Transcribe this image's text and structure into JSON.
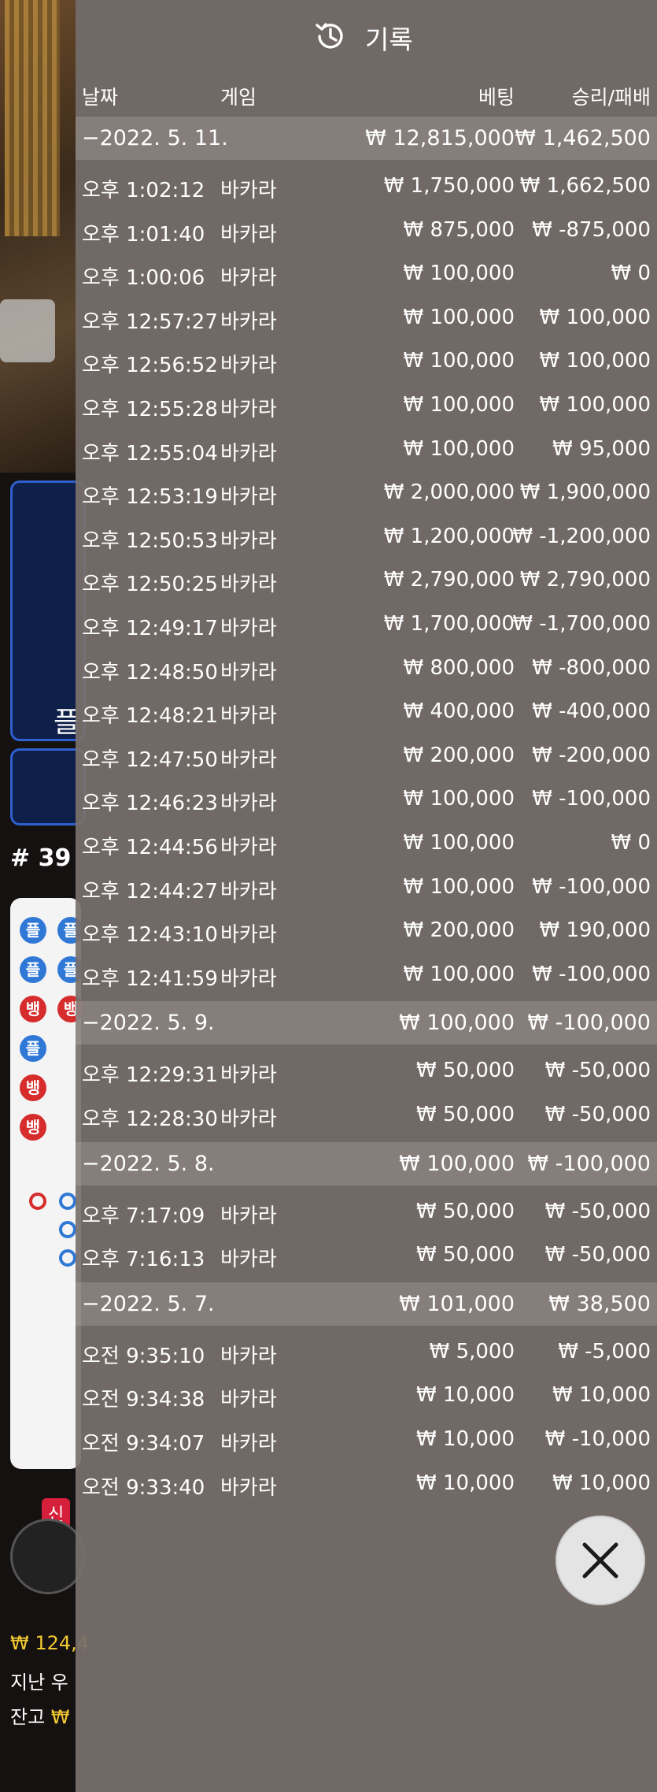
{
  "header": {
    "title": "기록",
    "icon": "history-icon"
  },
  "columns": {
    "date": "날짜",
    "game": "게임",
    "bet": "베팅",
    "result": "승리/패배"
  },
  "groups": [
    {
      "date": "−2022. 5. 11.",
      "bet": "₩ 12,815,000",
      "result": "₩ 1,462,500",
      "rows": [
        {
          "time": "오후 1:02:12",
          "game": "바카라",
          "bet": "₩ 1,750,000",
          "result": "₩ 1,662,500"
        },
        {
          "time": "오후 1:01:40",
          "game": "바카라",
          "bet": "₩ 875,000",
          "result": "₩ -875,000"
        },
        {
          "time": "오후 1:00:06",
          "game": "바카라",
          "bet": "₩ 100,000",
          "result": "₩ 0"
        },
        {
          "time": "오후 12:57:27",
          "game": "바카라",
          "bet": "₩ 100,000",
          "result": "₩ 100,000"
        },
        {
          "time": "오후 12:56:52",
          "game": "바카라",
          "bet": "₩ 100,000",
          "result": "₩ 100,000"
        },
        {
          "time": "오후 12:55:28",
          "game": "바카라",
          "bet": "₩ 100,000",
          "result": "₩ 100,000"
        },
        {
          "time": "오후 12:55:04",
          "game": "바카라",
          "bet": "₩ 100,000",
          "result": "₩ 95,000"
        },
        {
          "time": "오후 12:53:19",
          "game": "바카라",
          "bet": "₩ 2,000,000",
          "result": "₩ 1,900,000"
        },
        {
          "time": "오후 12:50:53",
          "game": "바카라",
          "bet": "₩ 1,200,000",
          "result": "₩ -1,200,000"
        },
        {
          "time": "오후 12:50:25",
          "game": "바카라",
          "bet": "₩ 2,790,000",
          "result": "₩ 2,790,000"
        },
        {
          "time": "오후 12:49:17",
          "game": "바카라",
          "bet": "₩ 1,700,000",
          "result": "₩ -1,700,000"
        },
        {
          "time": "오후 12:48:50",
          "game": "바카라",
          "bet": "₩ 800,000",
          "result": "₩ -800,000"
        },
        {
          "time": "오후 12:48:21",
          "game": "바카라",
          "bet": "₩ 400,000",
          "result": "₩ -400,000"
        },
        {
          "time": "오후 12:47:50",
          "game": "바카라",
          "bet": "₩ 200,000",
          "result": "₩ -200,000"
        },
        {
          "time": "오후 12:46:23",
          "game": "바카라",
          "bet": "₩ 100,000",
          "result": "₩ -100,000"
        },
        {
          "time": "오후 12:44:56",
          "game": "바카라",
          "bet": "₩ 100,000",
          "result": "₩ 0"
        },
        {
          "time": "오후 12:44:27",
          "game": "바카라",
          "bet": "₩ 100,000",
          "result": "₩ -100,000"
        },
        {
          "time": "오후 12:43:10",
          "game": "바카라",
          "bet": "₩ 200,000",
          "result": "₩ 190,000"
        },
        {
          "time": "오후 12:41:59",
          "game": "바카라",
          "bet": "₩ 100,000",
          "result": "₩ -100,000"
        }
      ]
    },
    {
      "date": "−2022. 5. 9.",
      "bet": "₩ 100,000",
      "result": "₩ -100,000",
      "rows": [
        {
          "time": "오후 12:29:31",
          "game": "바카라",
          "bet": "₩ 50,000",
          "result": "₩ -50,000"
        },
        {
          "time": "오후 12:28:30",
          "game": "바카라",
          "bet": "₩ 50,000",
          "result": "₩ -50,000"
        }
      ]
    },
    {
      "date": "−2022. 5. 8.",
      "bet": "₩ 100,000",
      "result": "₩ -100,000",
      "rows": [
        {
          "time": "오후 7:17:09",
          "game": "바카라",
          "bet": "₩ 50,000",
          "result": "₩ -50,000"
        },
        {
          "time": "오후 7:16:13",
          "game": "바카라",
          "bet": "₩ 50,000",
          "result": "₩ -50,000"
        }
      ]
    },
    {
      "date": "−2022. 5. 7.",
      "bet": "₩ 101,000",
      "result": "₩ 38,500",
      "rows": [
        {
          "time": "오전 9:35:10",
          "game": "바카라",
          "bet": "₩ 5,000",
          "result": "₩ -5,000"
        },
        {
          "time": "오전 9:34:38",
          "game": "바카라",
          "bet": "₩ 10,000",
          "result": "₩ 10,000"
        },
        {
          "time": "오전 9:34:07",
          "game": "바카라",
          "bet": "₩ 10,000",
          "result": "₩ -10,000"
        },
        {
          "time": "오전 9:33:40",
          "game": "바카라",
          "bet": "₩ 10,000",
          "result": "₩ 10,000"
        }
      ]
    }
  ],
  "close_button": {
    "icon": "close-icon"
  },
  "background": {
    "bet_label": "플",
    "round": "# 39",
    "road_player": "플",
    "road_banker": "뱅",
    "new_badge": "신",
    "balance_line1_prefix": "₩ 124,4",
    "balance_line2": "지난 우",
    "balance_line3_prefix": "잔고 ",
    "balance_line3_value": "₩"
  },
  "colors": {
    "overlay": "#78706c",
    "player": "#2f78d6",
    "banker": "#d62c2c",
    "gold": "#f0c832"
  }
}
